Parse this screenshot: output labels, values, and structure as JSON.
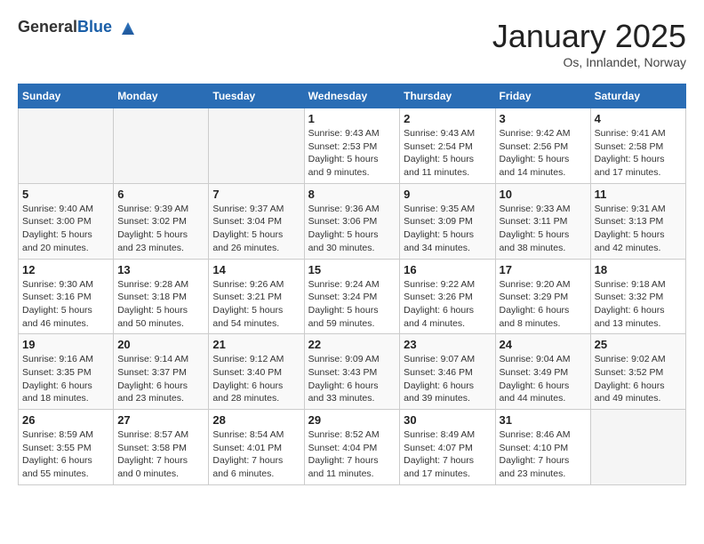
{
  "header": {
    "logo_general": "General",
    "logo_blue": "Blue",
    "title": "January 2025",
    "location": "Os, Innlandet, Norway"
  },
  "days_of_week": [
    "Sunday",
    "Monday",
    "Tuesday",
    "Wednesday",
    "Thursday",
    "Friday",
    "Saturday"
  ],
  "weeks": [
    [
      {
        "day": "",
        "info": ""
      },
      {
        "day": "",
        "info": ""
      },
      {
        "day": "",
        "info": ""
      },
      {
        "day": "1",
        "info": "Sunrise: 9:43 AM\nSunset: 2:53 PM\nDaylight: 5 hours\nand 9 minutes."
      },
      {
        "day": "2",
        "info": "Sunrise: 9:43 AM\nSunset: 2:54 PM\nDaylight: 5 hours\nand 11 minutes."
      },
      {
        "day": "3",
        "info": "Sunrise: 9:42 AM\nSunset: 2:56 PM\nDaylight: 5 hours\nand 14 minutes."
      },
      {
        "day": "4",
        "info": "Sunrise: 9:41 AM\nSunset: 2:58 PM\nDaylight: 5 hours\nand 17 minutes."
      }
    ],
    [
      {
        "day": "5",
        "info": "Sunrise: 9:40 AM\nSunset: 3:00 PM\nDaylight: 5 hours\nand 20 minutes."
      },
      {
        "day": "6",
        "info": "Sunrise: 9:39 AM\nSunset: 3:02 PM\nDaylight: 5 hours\nand 23 minutes."
      },
      {
        "day": "7",
        "info": "Sunrise: 9:37 AM\nSunset: 3:04 PM\nDaylight: 5 hours\nand 26 minutes."
      },
      {
        "day": "8",
        "info": "Sunrise: 9:36 AM\nSunset: 3:06 PM\nDaylight: 5 hours\nand 30 minutes."
      },
      {
        "day": "9",
        "info": "Sunrise: 9:35 AM\nSunset: 3:09 PM\nDaylight: 5 hours\nand 34 minutes."
      },
      {
        "day": "10",
        "info": "Sunrise: 9:33 AM\nSunset: 3:11 PM\nDaylight: 5 hours\nand 38 minutes."
      },
      {
        "day": "11",
        "info": "Sunrise: 9:31 AM\nSunset: 3:13 PM\nDaylight: 5 hours\nand 42 minutes."
      }
    ],
    [
      {
        "day": "12",
        "info": "Sunrise: 9:30 AM\nSunset: 3:16 PM\nDaylight: 5 hours\nand 46 minutes."
      },
      {
        "day": "13",
        "info": "Sunrise: 9:28 AM\nSunset: 3:18 PM\nDaylight: 5 hours\nand 50 minutes."
      },
      {
        "day": "14",
        "info": "Sunrise: 9:26 AM\nSunset: 3:21 PM\nDaylight: 5 hours\nand 54 minutes."
      },
      {
        "day": "15",
        "info": "Sunrise: 9:24 AM\nSunset: 3:24 PM\nDaylight: 5 hours\nand 59 minutes."
      },
      {
        "day": "16",
        "info": "Sunrise: 9:22 AM\nSunset: 3:26 PM\nDaylight: 6 hours\nand 4 minutes."
      },
      {
        "day": "17",
        "info": "Sunrise: 9:20 AM\nSunset: 3:29 PM\nDaylight: 6 hours\nand 8 minutes."
      },
      {
        "day": "18",
        "info": "Sunrise: 9:18 AM\nSunset: 3:32 PM\nDaylight: 6 hours\nand 13 minutes."
      }
    ],
    [
      {
        "day": "19",
        "info": "Sunrise: 9:16 AM\nSunset: 3:35 PM\nDaylight: 6 hours\nand 18 minutes."
      },
      {
        "day": "20",
        "info": "Sunrise: 9:14 AM\nSunset: 3:37 PM\nDaylight: 6 hours\nand 23 minutes."
      },
      {
        "day": "21",
        "info": "Sunrise: 9:12 AM\nSunset: 3:40 PM\nDaylight: 6 hours\nand 28 minutes."
      },
      {
        "day": "22",
        "info": "Sunrise: 9:09 AM\nSunset: 3:43 PM\nDaylight: 6 hours\nand 33 minutes."
      },
      {
        "day": "23",
        "info": "Sunrise: 9:07 AM\nSunset: 3:46 PM\nDaylight: 6 hours\nand 39 minutes."
      },
      {
        "day": "24",
        "info": "Sunrise: 9:04 AM\nSunset: 3:49 PM\nDaylight: 6 hours\nand 44 minutes."
      },
      {
        "day": "25",
        "info": "Sunrise: 9:02 AM\nSunset: 3:52 PM\nDaylight: 6 hours\nand 49 minutes."
      }
    ],
    [
      {
        "day": "26",
        "info": "Sunrise: 8:59 AM\nSunset: 3:55 PM\nDaylight: 6 hours\nand 55 minutes."
      },
      {
        "day": "27",
        "info": "Sunrise: 8:57 AM\nSunset: 3:58 PM\nDaylight: 7 hours\nand 0 minutes."
      },
      {
        "day": "28",
        "info": "Sunrise: 8:54 AM\nSunset: 4:01 PM\nDaylight: 7 hours\nand 6 minutes."
      },
      {
        "day": "29",
        "info": "Sunrise: 8:52 AM\nSunset: 4:04 PM\nDaylight: 7 hours\nand 11 minutes."
      },
      {
        "day": "30",
        "info": "Sunrise: 8:49 AM\nSunset: 4:07 PM\nDaylight: 7 hours\nand 17 minutes."
      },
      {
        "day": "31",
        "info": "Sunrise: 8:46 AM\nSunset: 4:10 PM\nDaylight: 7 hours\nand 23 minutes."
      },
      {
        "day": "",
        "info": ""
      }
    ]
  ]
}
